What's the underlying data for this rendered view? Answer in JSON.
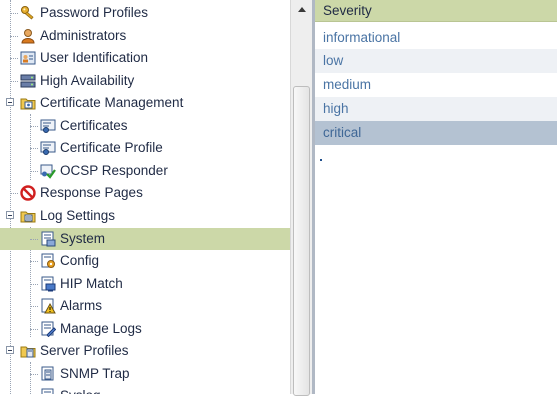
{
  "tree": {
    "items": [
      {
        "label": "Password Profiles",
        "icon": "key-icon"
      },
      {
        "label": "Administrators",
        "icon": "user-icon"
      },
      {
        "label": "User Identification",
        "icon": "user-id-icon"
      },
      {
        "label": "High Availability",
        "icon": "servers-icon"
      },
      {
        "label": "Certificate Management",
        "icon": "folder-icon",
        "expanded": true
      },
      {
        "label": "Certificates",
        "icon": "certificate-icon"
      },
      {
        "label": "Certificate Profile",
        "icon": "certificate-icon"
      },
      {
        "label": "OCSP Responder",
        "icon": "ocsp-check-icon"
      },
      {
        "label": "Response Pages",
        "icon": "no-entry-icon"
      },
      {
        "label": "Log Settings",
        "icon": "folder-icon",
        "expanded": true
      },
      {
        "label": "System",
        "icon": "log-document-icon",
        "selected": true
      },
      {
        "label": "Config",
        "icon": "config-document-icon"
      },
      {
        "label": "HIP Match",
        "icon": "hip-match-icon"
      },
      {
        "label": "Alarms",
        "icon": "alarm-icon"
      },
      {
        "label": "Manage Logs",
        "icon": "manage-logs-icon"
      },
      {
        "label": "Server Profiles",
        "icon": "folder-icon",
        "expanded": true
      },
      {
        "label": "SNMP Trap",
        "icon": "snmp-icon"
      },
      {
        "label": "Syslog",
        "icon": "syslog-icon"
      }
    ]
  },
  "grid": {
    "header": "Severity",
    "rows": [
      "informational",
      "low",
      "medium",
      "high",
      "critical"
    ]
  },
  "colors": {
    "selection": "#ccd8a8",
    "grid_selected": "#b4c2d2",
    "grid_text": "#4a74a4",
    "tree_text": "#1f2a44"
  }
}
